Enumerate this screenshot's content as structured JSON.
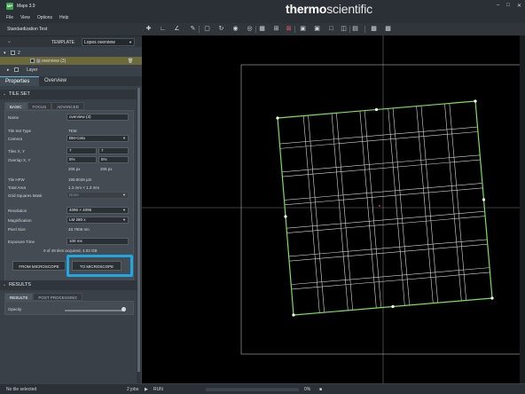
{
  "window": {
    "title": "Maps 3.9",
    "icon_text": "MP"
  },
  "menu": [
    "File",
    "View",
    "Options",
    "Help"
  ],
  "brand": {
    "part1": "thermo",
    "part2": "scientific"
  },
  "project": {
    "name": "Standardization Test"
  },
  "template": {
    "label": "TEMPLATE",
    "value": "Lopes overview"
  },
  "tree": {
    "node": "2",
    "selected_item": "overview (3)",
    "layer": "Layer"
  },
  "tabs": {
    "properties": "Properties",
    "overview": "Overview"
  },
  "tile_set": {
    "header": "TILE SET",
    "subtabs": [
      "BASIC",
      "FOCUS",
      "ADVANCED"
    ],
    "fields": {
      "name_label": "Name",
      "name_value": "overview (3)",
      "tile_set_type_label": "Tile Set Type",
      "tile_set_type_value": "TEM",
      "camera_label": "Camera",
      "camera_value": "BM-Ceta",
      "tiles_label": "Tiles X, Y",
      "tiles_x": "7",
      "tiles_y": "7",
      "overlap_label": "Overlap X, Y",
      "overlap_x": "5%",
      "overlap_y": "5%",
      "overlap_px_x": "205 px",
      "overlap_px_y": "205 px",
      "tile_hfw_label": "Tile HFW",
      "tile_hfw_value": "199.8049 µm",
      "total_area_label": "Total Area",
      "total_area_value": "1.3 mm × 1.3 mm",
      "grid_mask_label": "Grid Squares Mask",
      "grid_mask_value": "None",
      "resolution_label": "Resolution",
      "resolution_value": "4096 × 4096",
      "magnification_label": "Magnification",
      "magnification_value": "LM 280 x",
      "pixel_size_label": "Pixel Size",
      "pixel_size_value": "48.7805 nm",
      "exposure_label": "Exposure Time",
      "exposure_value": "100 ms"
    },
    "acquired_text": "0 of 49 tiles acquired, 4.03 GB",
    "from_microscope": "FROM MICROSCOPE",
    "to_microscope": "TO MICROSCOPE"
  },
  "results": {
    "header": "RESULTS",
    "subtabs": [
      "RESULTS",
      "POST PROCESSING"
    ],
    "opacity_label": "Opacity",
    "opacity_value": 0.98
  },
  "status": {
    "left": "No tile selected",
    "jobs": "2 jobs",
    "run": "RUN",
    "progress_text": "0%",
    "progress_value": 0
  },
  "colors": {
    "accent": "#1ea7e1",
    "grid": "#7be05a",
    "selected": "#6c6a3d"
  },
  "icons": [
    "move-icon",
    "axes-icon",
    "measure-icon",
    "ruler-icon",
    "select-icon",
    "rotate-icon",
    "camera-icon",
    "acquire-icon",
    "tile-icon",
    "add-icon",
    "zoom-in-icon",
    "zoom-out-icon",
    "fit-icon",
    "layout-icon",
    "export-icon",
    "pin-icon",
    "display-icon",
    "settings-icon"
  ]
}
